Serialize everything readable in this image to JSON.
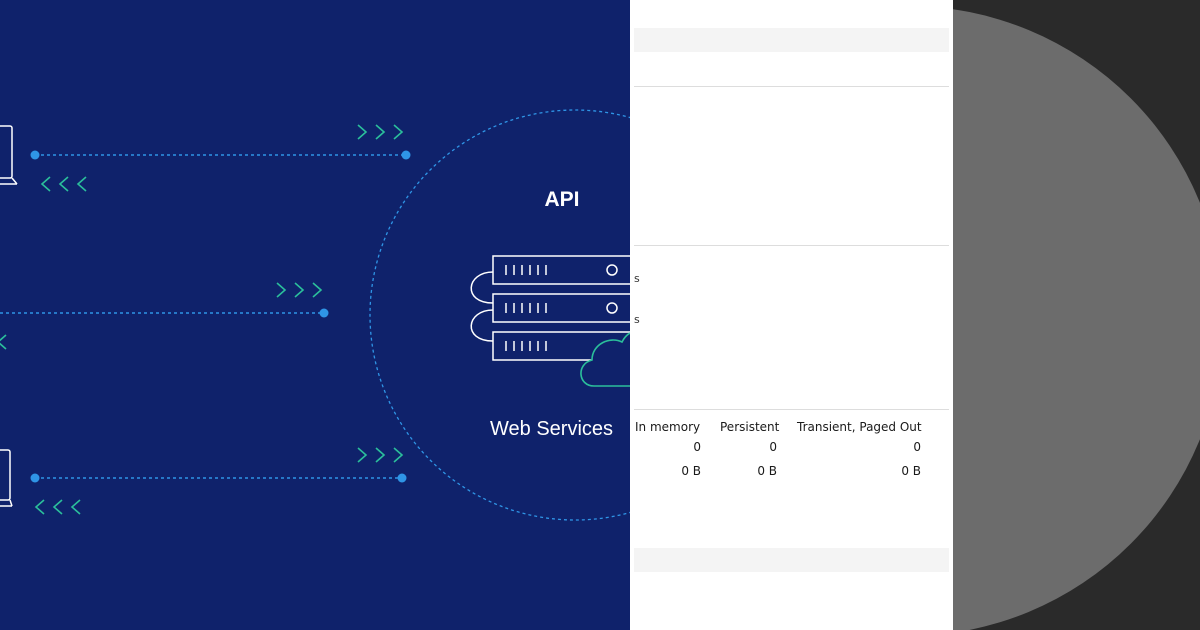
{
  "illustration": {
    "api_title": "API",
    "services_caption": "Web Services",
    "icons": [
      "laptop-icon",
      "laptop-icon",
      "server-rack-icon",
      "cloud-icon"
    ],
    "colors": {
      "background": "#0f226b",
      "connection": "#2f95e6",
      "arrows": "#2bbf9b",
      "outline": "#ffffff"
    }
  },
  "stats": {
    "stubs": [
      "s",
      "s"
    ],
    "columns": [
      "In memory",
      "Persistent",
      "Transient, Paged Out"
    ],
    "rows": [
      [
        "0",
        "0",
        "0"
      ],
      [
        "0 B",
        "0 B",
        "0 B"
      ]
    ]
  },
  "backdrop": {
    "colors": {
      "background": "#2a2a2a",
      "disc": "#6c6c6c"
    }
  }
}
